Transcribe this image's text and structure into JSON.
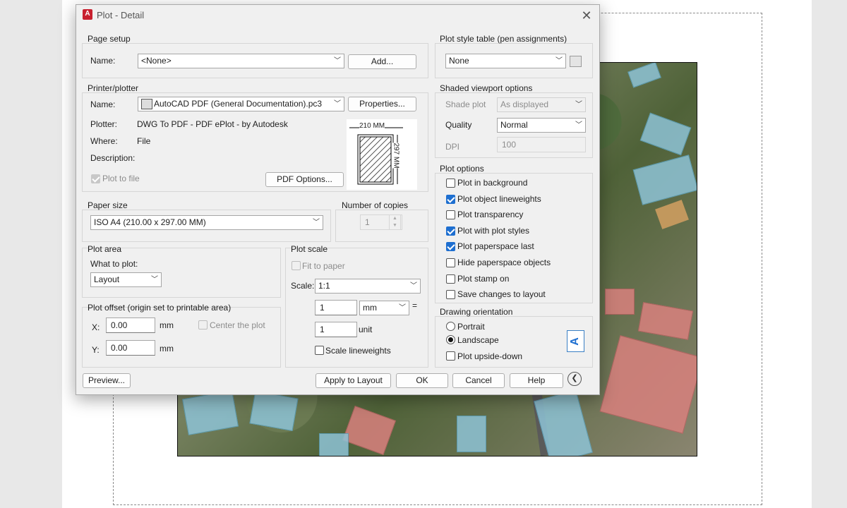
{
  "window": {
    "title": "Plot - Detail",
    "app_icon": "A"
  },
  "page_setup": {
    "group": "Page setup",
    "name_label": "Name:",
    "name_value": "<None>",
    "add_button": "Add..."
  },
  "printer": {
    "group": "Printer/plotter",
    "name_label": "Name:",
    "name_value": "AutoCAD PDF (General Documentation).pc3",
    "properties_button": "Properties...",
    "plotter_label": "Plotter:",
    "plotter_value": "DWG To PDF - PDF ePlot - by Autodesk",
    "where_label": "Where:",
    "where_value": "File",
    "description_label": "Description:",
    "plot_to_file": "Plot to file",
    "pdf_options_button": "PDF Options...",
    "preview_width": "210  MM",
    "preview_height": "297  MM"
  },
  "paper_size": {
    "group": "Paper size",
    "value": "ISO A4 (210.00 x 297.00 MM)"
  },
  "copies": {
    "group": "Number of copies",
    "value": "1"
  },
  "plot_area": {
    "group": "Plot area",
    "what_label": "What to plot:",
    "what_value": "Layout"
  },
  "plot_offset": {
    "group": "Plot offset (origin set to printable area)",
    "x_label": "X:",
    "x_value": "0.00",
    "x_unit": "mm",
    "y_label": "Y:",
    "y_value": "0.00",
    "y_unit": "mm",
    "center": "Center the plot"
  },
  "plot_scale": {
    "group": "Plot scale",
    "fit": "Fit to paper",
    "scale_label": "Scale:",
    "scale_value": "1:1",
    "num": "1",
    "unit_select": "mm",
    "equals": "=",
    "den": "1",
    "den_unit": "unit",
    "scale_lw": "Scale lineweights"
  },
  "plot_style": {
    "group": "Plot style table (pen assignments)",
    "value": "None"
  },
  "shaded": {
    "group": "Shaded viewport options",
    "shade_label": "Shade plot",
    "shade_value": "As displayed",
    "quality_label": "Quality",
    "quality_value": "Normal",
    "dpi_label": "DPI",
    "dpi_value": "100"
  },
  "plot_options": {
    "group": "Plot options",
    "items": [
      {
        "label": "Plot in background",
        "checked": false
      },
      {
        "label": "Plot object lineweights",
        "checked": true
      },
      {
        "label": "Plot transparency",
        "checked": false
      },
      {
        "label": "Plot with plot styles",
        "checked": true
      },
      {
        "label": "Plot paperspace last",
        "checked": true
      },
      {
        "label": "Hide paperspace objects",
        "checked": false
      },
      {
        "label": "Plot stamp on",
        "checked": false
      },
      {
        "label": "Save changes to layout",
        "checked": false
      }
    ]
  },
  "orientation": {
    "group": "Drawing orientation",
    "portrait": "Portrait",
    "landscape": "Landscape",
    "upside_down": "Plot upside-down",
    "icon_letter": "A"
  },
  "footer": {
    "preview": "Preview...",
    "apply": "Apply to Layout",
    "ok": "OK",
    "cancel": "Cancel",
    "help": "Help"
  }
}
